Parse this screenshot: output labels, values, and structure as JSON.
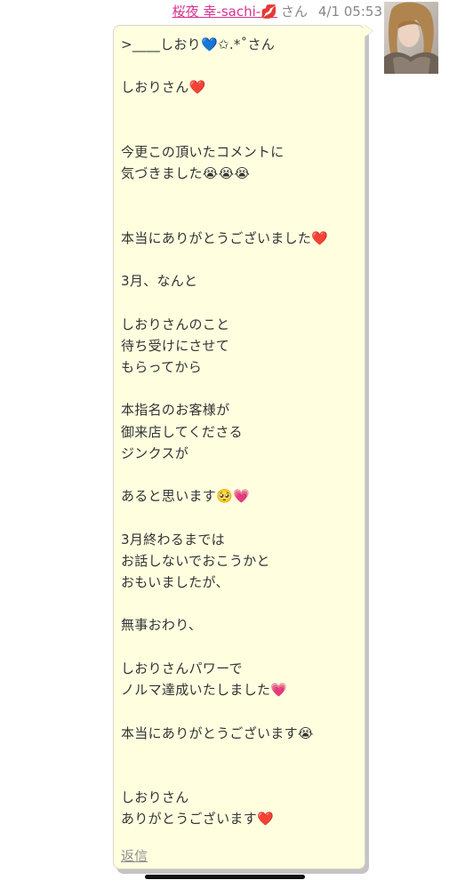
{
  "post": {
    "sender_name": "桜夜 幸-sachi-💋",
    "sender_suffix": "さん",
    "timestamp": "4/1 05:53",
    "message": ">____しおり💙✩.*˚さん\n\nしおりさん❤️\n\n\n今更この頂いたコメントに\n気づきました😭😭😭\n\n\n本当にありがとうございました❤️\n\n3月、なんと\n\nしおりさんのこと\n待ち受けにさせて\nもらってから\n\n本指名のお客様が\n御来店してくださる\nジンクスが\n\nあると思います🥺💗\n\n3月終わるまでは\nお話しないでおこうかと\nおもいましたが、\n\n無事おわり、\n\nしおりさんパワーで\nノルマ達成いたしました💗\n\n本当にありがとうございます😭\n\n\nしおりさん\nありがとうございます❤️",
    "reply_label": "返信"
  },
  "colors": {
    "sender_name": "#d6338f",
    "bubble_background": "#ffffe0",
    "text": "#333333",
    "muted": "#888888"
  },
  "icons": {
    "avatar": "avatar-photo"
  }
}
